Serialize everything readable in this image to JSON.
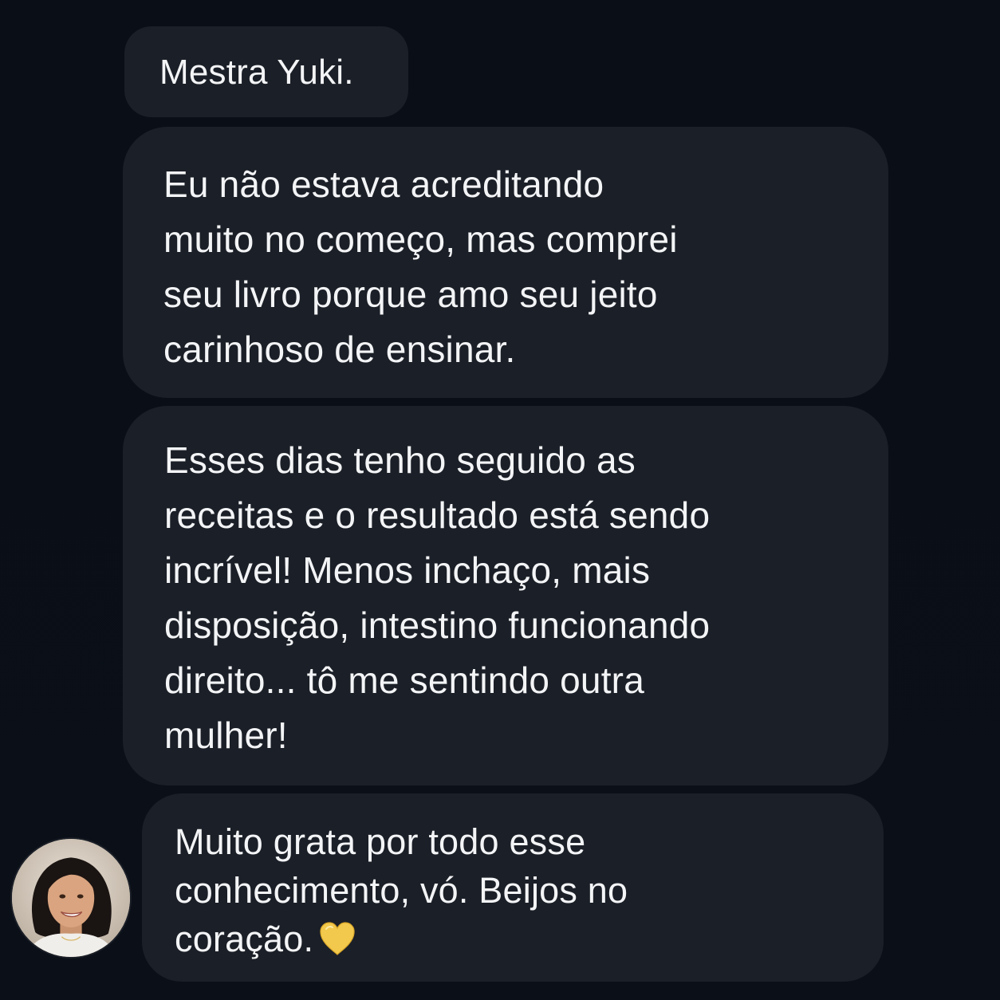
{
  "messages": [
    {
      "text": "Mestra Yuki."
    },
    {
      "text": "Eu não estava acreditando\nmuito no começo, mas comprei\nseu livro porque amo seu jeito\ncarinhoso de ensinar."
    },
    {
      "text": "Esses dias tenho seguido as\nreceitas e o resultado está sendo\nincrível! Menos inchaço, mais\ndisposição, intestino funcionando\ndireito... tô me sentindo outra\nmulher!"
    },
    {
      "text": "Muito grata por todo esse\nconhecimento, vó. Beijos no\ncoração.",
      "emoji": "yellow-heart-icon"
    }
  ],
  "colors": {
    "background": "#0b0f17",
    "bubble": "#1b1f27",
    "text": "#f3f4f6",
    "heart": "#f2c94c"
  }
}
